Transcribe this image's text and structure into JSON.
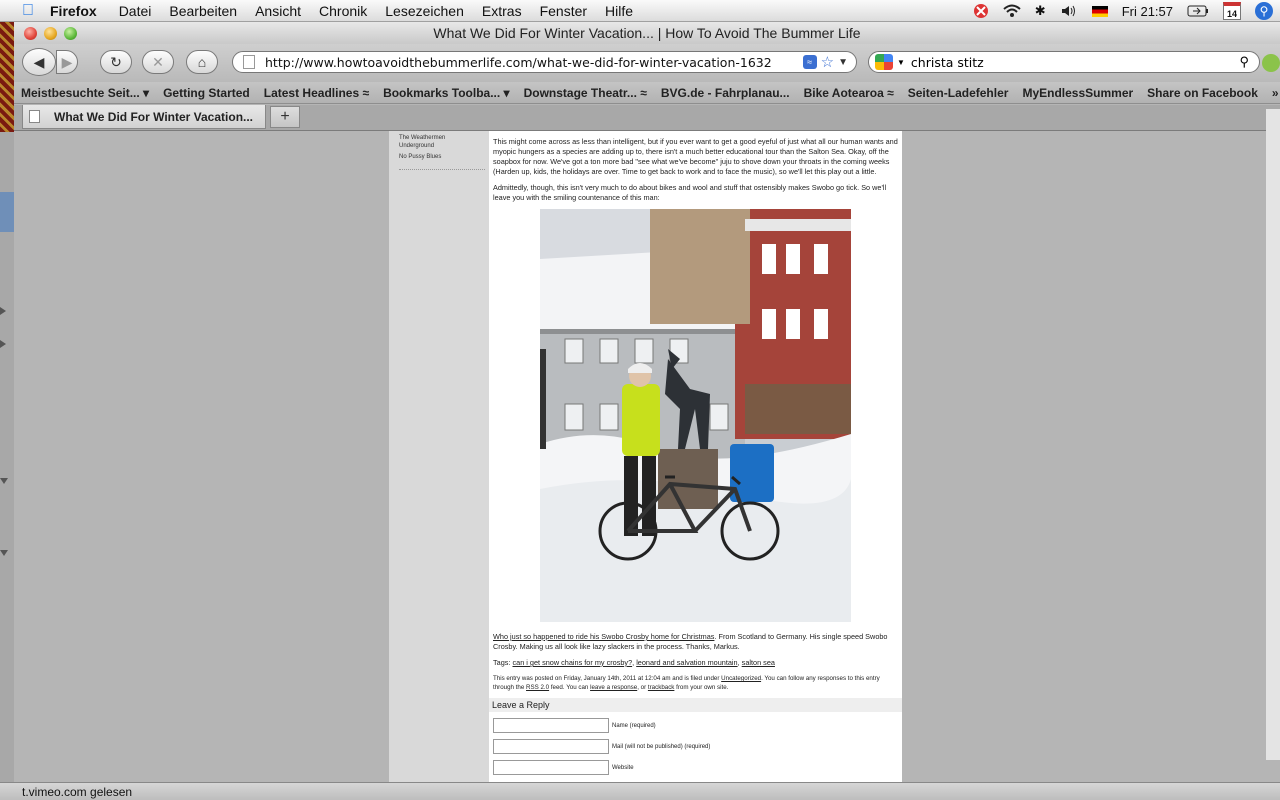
{
  "menubar": {
    "app": "Firefox",
    "items": [
      "Datei",
      "Bearbeiten",
      "Ansicht",
      "Chronik",
      "Lesezeichen",
      "Extras",
      "Fenster",
      "Hilfe"
    ],
    "clock": "Fri 21:57",
    "calendar_day": "14"
  },
  "window": {
    "title": "What We Did For Winter Vacation... | How To Avoid The Bummer Life"
  },
  "toolbar": {
    "url": "http://www.howtoavoidthebummerlife.com/what-we-did-for-winter-vacation-1632",
    "search": "christa stitz"
  },
  "bookmarks": [
    {
      "label": "Meistbesuchte Seit...",
      "icon": "dropdown"
    },
    {
      "label": "Getting Started",
      "icon": ""
    },
    {
      "label": "Latest Headlines",
      "icon": "rss"
    },
    {
      "label": "Bookmarks Toolba...",
      "icon": "dropdown"
    },
    {
      "label": "Downstage Theatr...",
      "icon": "rss"
    },
    {
      "label": "BVG.de - Fahrplanau...",
      "icon": ""
    },
    {
      "label": "Bike Aotearoa",
      "icon": "rss"
    },
    {
      "label": "Seiten-Ladefehler",
      "icon": ""
    },
    {
      "label": "MyEndlessSummer",
      "icon": ""
    },
    {
      "label": "Share on Facebook",
      "icon": ""
    }
  ],
  "tabs": [
    {
      "label": "What We Did For Winter Vacation...",
      "active": true
    }
  ],
  "sidebar": {
    "links": [
      "The Weathermen",
      "Underground",
      "No Pussy Blues"
    ]
  },
  "post": {
    "para1": "This might come across as less than intelligent, but if you ever want to get a good eyeful of just what all our human wants and myopic hungers as a species are adding up to, there isn't a much better educational tour than the Salton Sea. Okay, off the soapbox for now. We've got a ton more bad \"see what we've become\" juju to shove down your throats in the coming weeks (Harden up, kids, the holidays are over. Time to get back to work and to face the music), so we'll let this play out a little.",
    "para2": "Admittedly, though, this isn't very much to do about bikes and wool and stuff that ostensibly makes Swobo go tick. So we'll leave you with the smiling countenance of this man:",
    "caption_link": "Who just so happened to ride his Swobo Crosby home for Christmas",
    "caption_rest": ". From Scotland to Germany. His single speed Swobo Crosby. Making us all look like lazy slackers in the process. Thanks, Markus.",
    "tags_label": "Tags:",
    "tags": [
      "can i get snow chains for my crosby?",
      "leonard and salvation mountain",
      "salton sea"
    ],
    "meta1": "This entry was posted on Friday, January 14th, 2011 at 12:04 am and is filed under",
    "meta_category": "Uncategorized",
    "meta2": ". You can follow any responses to this entry through the",
    "meta_rss": "RSS 2.0",
    "meta3": "feed. You can",
    "meta_leave": "leave a response",
    "meta4": ", or",
    "meta_trackback": "trackback",
    "meta5": "from your own site.",
    "reply_title": "Leave a Reply",
    "fields": [
      "Name (required)",
      "Mail (will not be published) (required)",
      "Website"
    ]
  },
  "status": "t.vimeo.com gelesen"
}
